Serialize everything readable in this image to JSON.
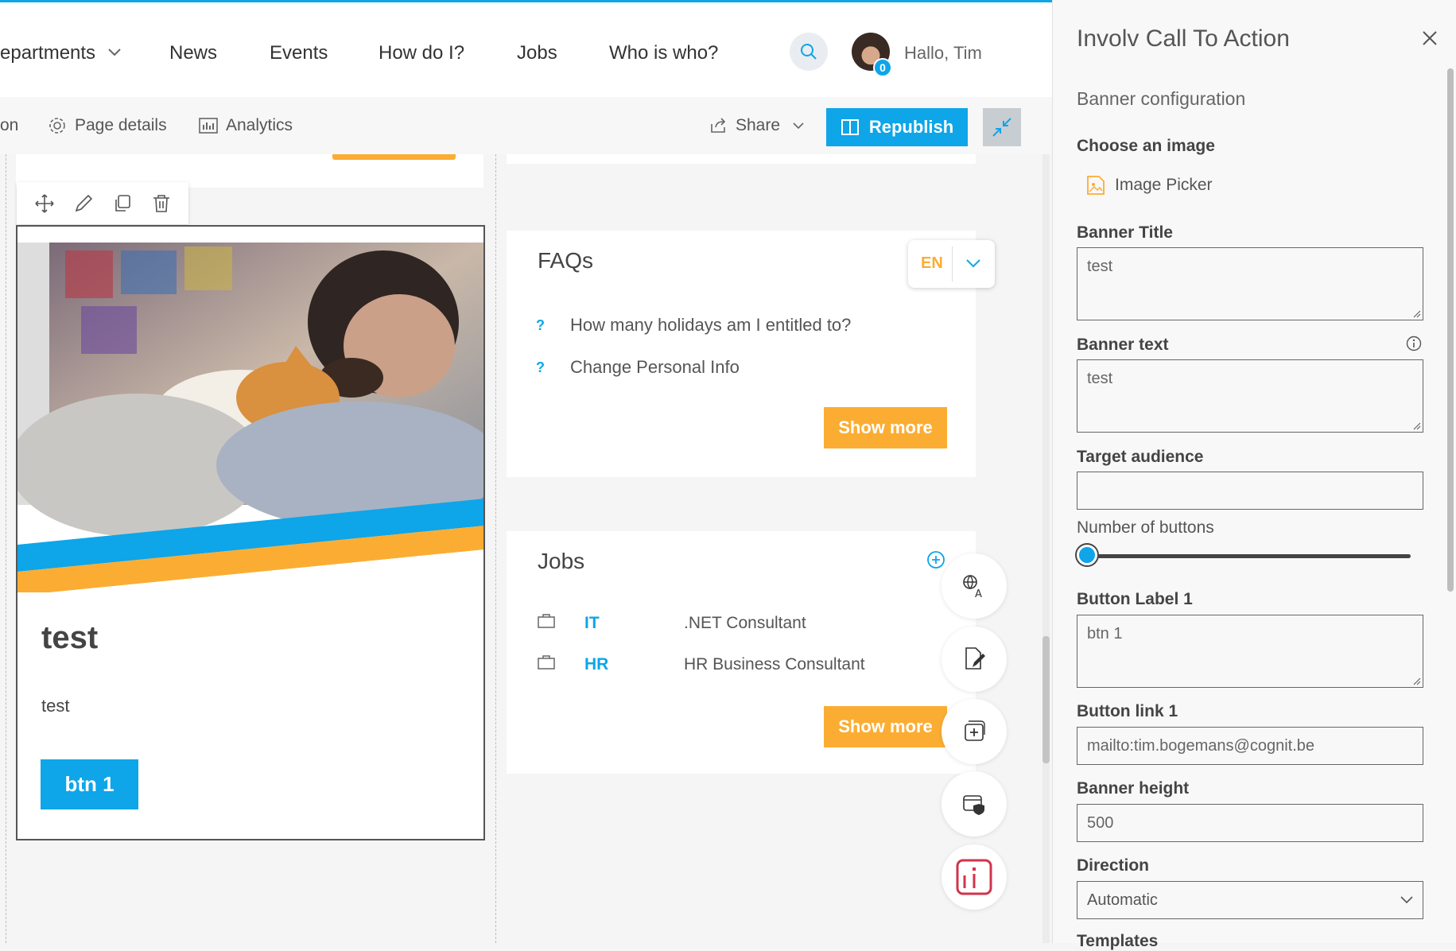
{
  "nav": {
    "items": [
      "epartments",
      "News",
      "Events",
      "How do I?",
      "Jobs",
      "Who is who?"
    ],
    "greeting": "Hallo, Tim",
    "notification_count": "0"
  },
  "cmdbar": {
    "partial_left": "on",
    "page_details": "Page details",
    "analytics": "Analytics",
    "share": "Share",
    "republish": "Republish"
  },
  "banner": {
    "title": "test",
    "text": "test",
    "button_label": "btn 1",
    "stripe_colors": [
      "#0ea5e9",
      "#fbad33"
    ]
  },
  "faqs": {
    "title": "FAQs",
    "language": "EN",
    "questions": [
      "How many holidays am I entitled to?",
      "Change Personal Info"
    ],
    "show_more": "Show more"
  },
  "jobs": {
    "title": "Jobs",
    "rows": [
      {
        "category": "IT",
        "title": ".NET Consultant"
      },
      {
        "category": "HR",
        "title": "HR Business Consultant"
      }
    ],
    "show_more": "Show more"
  },
  "panel": {
    "title": "Involv Call To Action",
    "section": "Banner configuration",
    "choose_image": "Choose an image",
    "image_picker": "Image Picker",
    "banner_title_label": "Banner Title",
    "banner_title_value": "test",
    "banner_text_label": "Banner text",
    "banner_text_value": "test",
    "target_audience_label": "Target audience",
    "target_audience_value": "",
    "num_buttons_label": "Number of buttons",
    "num_buttons_slider_fraction": 0,
    "button_label_1_label": "Button Label 1",
    "button_label_1_value": "btn 1",
    "button_link_1_label": "Button link 1",
    "button_link_1_value": "mailto:tim.bogemans@cognit.be",
    "banner_height_label": "Banner height",
    "banner_height_value": "500",
    "direction_label": "Direction",
    "direction_value": "Automatic",
    "templates_label": "Templates"
  },
  "colors": {
    "accent_blue": "#0ea5e9",
    "accent_orange": "#fbad33"
  }
}
